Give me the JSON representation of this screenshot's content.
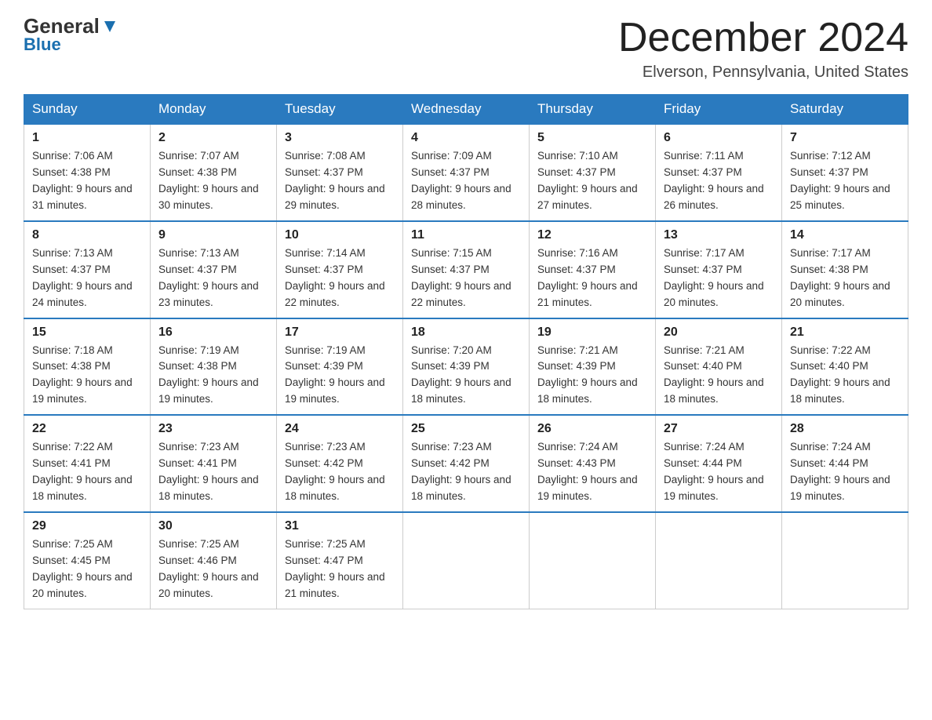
{
  "header": {
    "logo_general": "General",
    "logo_blue": "Blue",
    "month_title": "December 2024",
    "location": "Elverson, Pennsylvania, United States"
  },
  "weekdays": [
    "Sunday",
    "Monday",
    "Tuesday",
    "Wednesday",
    "Thursday",
    "Friday",
    "Saturday"
  ],
  "weeks": [
    [
      {
        "day": "1",
        "sunrise": "7:06 AM",
        "sunset": "4:38 PM",
        "daylight": "9 hours and 31 minutes."
      },
      {
        "day": "2",
        "sunrise": "7:07 AM",
        "sunset": "4:38 PM",
        "daylight": "9 hours and 30 minutes."
      },
      {
        "day": "3",
        "sunrise": "7:08 AM",
        "sunset": "4:37 PM",
        "daylight": "9 hours and 29 minutes."
      },
      {
        "day": "4",
        "sunrise": "7:09 AM",
        "sunset": "4:37 PM",
        "daylight": "9 hours and 28 minutes."
      },
      {
        "day": "5",
        "sunrise": "7:10 AM",
        "sunset": "4:37 PM",
        "daylight": "9 hours and 27 minutes."
      },
      {
        "day": "6",
        "sunrise": "7:11 AM",
        "sunset": "4:37 PM",
        "daylight": "9 hours and 26 minutes."
      },
      {
        "day": "7",
        "sunrise": "7:12 AM",
        "sunset": "4:37 PM",
        "daylight": "9 hours and 25 minutes."
      }
    ],
    [
      {
        "day": "8",
        "sunrise": "7:13 AM",
        "sunset": "4:37 PM",
        "daylight": "9 hours and 24 minutes."
      },
      {
        "day": "9",
        "sunrise": "7:13 AM",
        "sunset": "4:37 PM",
        "daylight": "9 hours and 23 minutes."
      },
      {
        "day": "10",
        "sunrise": "7:14 AM",
        "sunset": "4:37 PM",
        "daylight": "9 hours and 22 minutes."
      },
      {
        "day": "11",
        "sunrise": "7:15 AM",
        "sunset": "4:37 PM",
        "daylight": "9 hours and 22 minutes."
      },
      {
        "day": "12",
        "sunrise": "7:16 AM",
        "sunset": "4:37 PM",
        "daylight": "9 hours and 21 minutes."
      },
      {
        "day": "13",
        "sunrise": "7:17 AM",
        "sunset": "4:37 PM",
        "daylight": "9 hours and 20 minutes."
      },
      {
        "day": "14",
        "sunrise": "7:17 AM",
        "sunset": "4:38 PM",
        "daylight": "9 hours and 20 minutes."
      }
    ],
    [
      {
        "day": "15",
        "sunrise": "7:18 AM",
        "sunset": "4:38 PM",
        "daylight": "9 hours and 19 minutes."
      },
      {
        "day": "16",
        "sunrise": "7:19 AM",
        "sunset": "4:38 PM",
        "daylight": "9 hours and 19 minutes."
      },
      {
        "day": "17",
        "sunrise": "7:19 AM",
        "sunset": "4:39 PM",
        "daylight": "9 hours and 19 minutes."
      },
      {
        "day": "18",
        "sunrise": "7:20 AM",
        "sunset": "4:39 PM",
        "daylight": "9 hours and 18 minutes."
      },
      {
        "day": "19",
        "sunrise": "7:21 AM",
        "sunset": "4:39 PM",
        "daylight": "9 hours and 18 minutes."
      },
      {
        "day": "20",
        "sunrise": "7:21 AM",
        "sunset": "4:40 PM",
        "daylight": "9 hours and 18 minutes."
      },
      {
        "day": "21",
        "sunrise": "7:22 AM",
        "sunset": "4:40 PM",
        "daylight": "9 hours and 18 minutes."
      }
    ],
    [
      {
        "day": "22",
        "sunrise": "7:22 AM",
        "sunset": "4:41 PM",
        "daylight": "9 hours and 18 minutes."
      },
      {
        "day": "23",
        "sunrise": "7:23 AM",
        "sunset": "4:41 PM",
        "daylight": "9 hours and 18 minutes."
      },
      {
        "day": "24",
        "sunrise": "7:23 AM",
        "sunset": "4:42 PM",
        "daylight": "9 hours and 18 minutes."
      },
      {
        "day": "25",
        "sunrise": "7:23 AM",
        "sunset": "4:42 PM",
        "daylight": "9 hours and 18 minutes."
      },
      {
        "day": "26",
        "sunrise": "7:24 AM",
        "sunset": "4:43 PM",
        "daylight": "9 hours and 19 minutes."
      },
      {
        "day": "27",
        "sunrise": "7:24 AM",
        "sunset": "4:44 PM",
        "daylight": "9 hours and 19 minutes."
      },
      {
        "day": "28",
        "sunrise": "7:24 AM",
        "sunset": "4:44 PM",
        "daylight": "9 hours and 19 minutes."
      }
    ],
    [
      {
        "day": "29",
        "sunrise": "7:25 AM",
        "sunset": "4:45 PM",
        "daylight": "9 hours and 20 minutes."
      },
      {
        "day": "30",
        "sunrise": "7:25 AM",
        "sunset": "4:46 PM",
        "daylight": "9 hours and 20 minutes."
      },
      {
        "day": "31",
        "sunrise": "7:25 AM",
        "sunset": "4:47 PM",
        "daylight": "9 hours and 21 minutes."
      },
      null,
      null,
      null,
      null
    ]
  ]
}
